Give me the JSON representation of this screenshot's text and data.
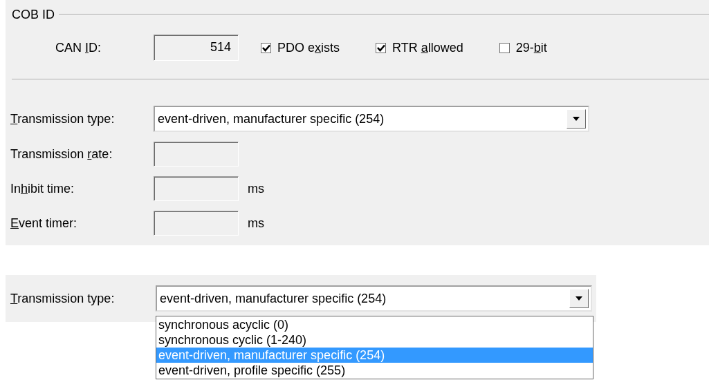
{
  "cob_id": {
    "title": "COB ID",
    "can_id": {
      "label": {
        "pre": "CAN ",
        "key": "I",
        "post": "D:"
      },
      "value": "514"
    },
    "checkboxes": [
      {
        "label": {
          "pre": "PDO e",
          "key": "x",
          "post": "ists"
        },
        "checked": true
      },
      {
        "label": {
          "pre": "RTR ",
          "key": "a",
          "post": "llowed"
        },
        "checked": true
      },
      {
        "label": {
          "pre": "29-",
          "key": "b",
          "post": "it"
        },
        "checked": false
      }
    ]
  },
  "settings": {
    "transmission_type": {
      "label": {
        "key": "T",
        "post": "ransmission type:"
      },
      "value": "event-driven, manufacturer specific (254)"
    },
    "fields": [
      {
        "label": {
          "pre": "Transmission ",
          "key": "r",
          "post": "ate:"
        }
      },
      {
        "label": {
          "pre": "In",
          "key": "h",
          "post": "ibit time:"
        },
        "unit": "ms"
      },
      {
        "label": {
          "key": "E",
          "post": "vent timer:"
        },
        "unit": "ms"
      }
    ]
  },
  "dropdown_example": {
    "label": {
      "key": "T",
      "post": "ransmission type:"
    },
    "value": "event-driven, manufacturer specific (254)",
    "options": [
      {
        "label": "synchronous acyclic (0)",
        "selected": false
      },
      {
        "label": "synchronous cyclic (1-240)",
        "selected": false
      },
      {
        "label": "event-driven, manufacturer specific (254)",
        "selected": true
      },
      {
        "label": "event-driven, profile specific (255)",
        "selected": false
      }
    ]
  }
}
